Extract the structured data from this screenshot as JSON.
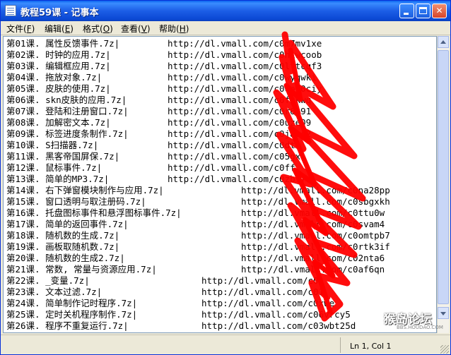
{
  "window": {
    "title": "教程59课 - 记事本"
  },
  "menu": [
    {
      "label": "文件",
      "key": "F"
    },
    {
      "label": "编辑",
      "key": "E"
    },
    {
      "label": "格式",
      "key": "O"
    },
    {
      "label": "查看",
      "key": "V"
    },
    {
      "label": "帮助",
      "key": "H"
    }
  ],
  "lines": [
    {
      "lesson": "第01课. 属性反馈事件.7z|",
      "url": "http://dl.vmall.com/c0m7mv1xe",
      "url_col": 228
    },
    {
      "lesson": "第02课. 时钟的应用.7z|",
      "url": "http://dl.vmall.com/c0hiwcoob",
      "url_col": 228
    },
    {
      "lesson": "第03课. 编辑框应用.7z|",
      "url": "http://dl.vmall.com/c0lttcqf3",
      "url_col": 228
    },
    {
      "lesson": "第04课. 拖放对象.7z|",
      "url": "http://dl.vmall.com/c0wyqwki",
      "url_col": 228
    },
    {
      "lesson": "第05课. 皮肤的使用.7z|",
      "url": "http://dl.vmall.com/c0op90ciy",
      "url_col": 228
    },
    {
      "lesson": "第06课. skn皮肤的应用.7z|",
      "url": "http://dl.vmall.com/c0fgkwq",
      "url_col": 228
    },
    {
      "lesson": "第07课. 登陆和注册窗口.7z|",
      "url": "http://dl.vmall.com/c0r6k91",
      "url_col": 228
    },
    {
      "lesson": "第08课. 加解密文本.7z|",
      "url": "http://dl.vmall.com/c0uze09",
      "url_col": 228
    },
    {
      "lesson": "第09课. 标签进度条制作.7z|",
      "url": "http://dl.vmall.com/c0jabc2",
      "url_col": 228
    },
    {
      "lesson": "第10课. S扫描器.7z|",
      "url": "http://dl.vmall.com/c0dt4",
      "url_col": 228
    },
    {
      "lesson": "第11课. 黑客帝国屏保.7z|",
      "url": "http://dl.vmall.com/c05gx",
      "url_col": 228
    },
    {
      "lesson": "第12课. 鼠标事件.7z|",
      "url": "http://dl.vmall.com/c0ff",
      "url_col": 228
    },
    {
      "lesson": "第13课. 简单的MP3.7z|",
      "url": "http://dl.vmall.com/c0zbff",
      "url_col": 228
    },
    {
      "lesson": "第14课. 右下弹窗模块制作与应用.7z|",
      "url": "http://dl.vmall.com/c0na28pp",
      "url_col": 332
    },
    {
      "lesson": "第15课. 窗口透明与取注册码.7z|",
      "url": "http://dl.vmall.com/c0sbgxkh",
      "url_col": 332
    },
    {
      "lesson": "第16课. 托盘图标事件和悬浮图标事件.7z|",
      "url": "http://dl.vmall.com/c0ttu0w",
      "url_col": 332
    },
    {
      "lesson": "第17课. 简单的返回事件.7z|",
      "url": "http://dl.vmall.com/c0svam4",
      "url_col": 332
    },
    {
      "lesson": "第18课. 随机数的生成.7z|",
      "url": "http://dl.vmall.com/c0omtpb7",
      "url_col": 332
    },
    {
      "lesson": "第19课. 画板取随机数.7z|",
      "url": "http://dl.vmall.com/c0rtk3if",
      "url_col": 332
    },
    {
      "lesson": "第20课. 随机数的生成2.7z|",
      "url": "http://dl.vmall.com/c02nta6",
      "url_col": 332
    },
    {
      "lesson": "第21课. 常数, 常量与资源应用.7z|",
      "url": "http://dl.vmall.com/c0af6qn",
      "url_col": 332
    },
    {
      "lesson": "第22课. _变量.7z|",
      "url": "http://dl.vmall.com/c0",
      "url_col": 276
    },
    {
      "lesson": "第23课. 文本过滤.7z|",
      "url": "http://dl.vmall.com/c01",
      "url_col": 276
    },
    {
      "lesson": "第24课. 简单制作记时程序.7z|",
      "url": "http://dl.vmall.com/c0xwe",
      "url_col": 276
    },
    {
      "lesson": "第25课. 定时关机程序制作.7z|",
      "url": "http://dl.vmall.com/c06vrcy5",
      "url_col": 276
    },
    {
      "lesson": "第26课. 程序不重复运行.7z|",
      "url": "http://dl.vmall.com/c03wbt25d",
      "url_col": 276
    }
  ],
  "status": {
    "position": "Ln 1, Col 1"
  },
  "watermark": {
    "main": "猴岛论坛",
    "sub": "BBS.HOUDAO.COM"
  },
  "colors": {
    "title_bar": "#0b48d4",
    "scribble": "#ff0000",
    "menu_bg": "#ece9d8"
  }
}
